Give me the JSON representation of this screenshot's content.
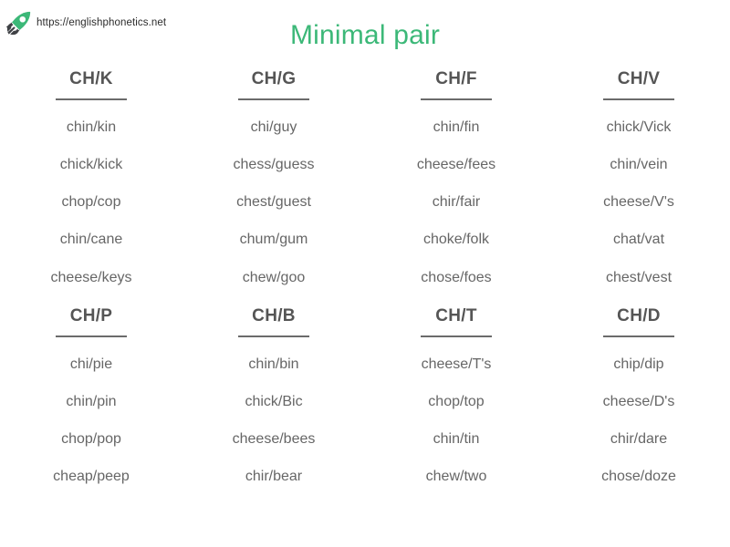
{
  "header": {
    "logo_icon": "rocket-icon",
    "url": "https://englishphonetics.net",
    "title": "Minimal pair",
    "title_color": "#3cb878"
  },
  "blocks": [
    {
      "columns": [
        {
          "header": "CH/K",
          "pairs": [
            "chin/kin",
            "chick/kick",
            "chop/cop",
            "chin/cane",
            "cheese/keys"
          ]
        },
        {
          "header": "CH/G",
          "pairs": [
            "chi/guy",
            "chess/guess",
            "chest/guest",
            "chum/gum",
            "chew/goo"
          ]
        },
        {
          "header": "CH/F",
          "pairs": [
            "chin/fin",
            "cheese/fees",
            "chir/fair",
            "choke/folk",
            "chose/foes"
          ]
        },
        {
          "header": "CH/V",
          "pairs": [
            "chick/Vick",
            "chin/vein",
            "cheese/V's",
            "chat/vat",
            "chest/vest"
          ]
        }
      ]
    },
    {
      "columns": [
        {
          "header": "CH/P",
          "pairs": [
            "chi/pie",
            "chin/pin",
            "chop/pop",
            "cheap/peep"
          ]
        },
        {
          "header": "CH/B",
          "pairs": [
            "chin/bin",
            "chick/Bic",
            "cheese/bees",
            "chir/bear"
          ]
        },
        {
          "header": "CH/T",
          "pairs": [
            "cheese/T's",
            "chop/top",
            "chin/tin",
            "chew/two"
          ]
        },
        {
          "header": "CH/D",
          "pairs": [
            "chip/dip",
            "cheese/D's",
            "chir/dare",
            "chose/doze"
          ]
        }
      ]
    }
  ],
  "colors": {
    "header_text": "#555555",
    "body_text": "#666666",
    "rule": "#6b6b6b",
    "accent_green": "#3cb878",
    "logo_body": "#3cb878",
    "logo_fin": "#3f4145"
  }
}
